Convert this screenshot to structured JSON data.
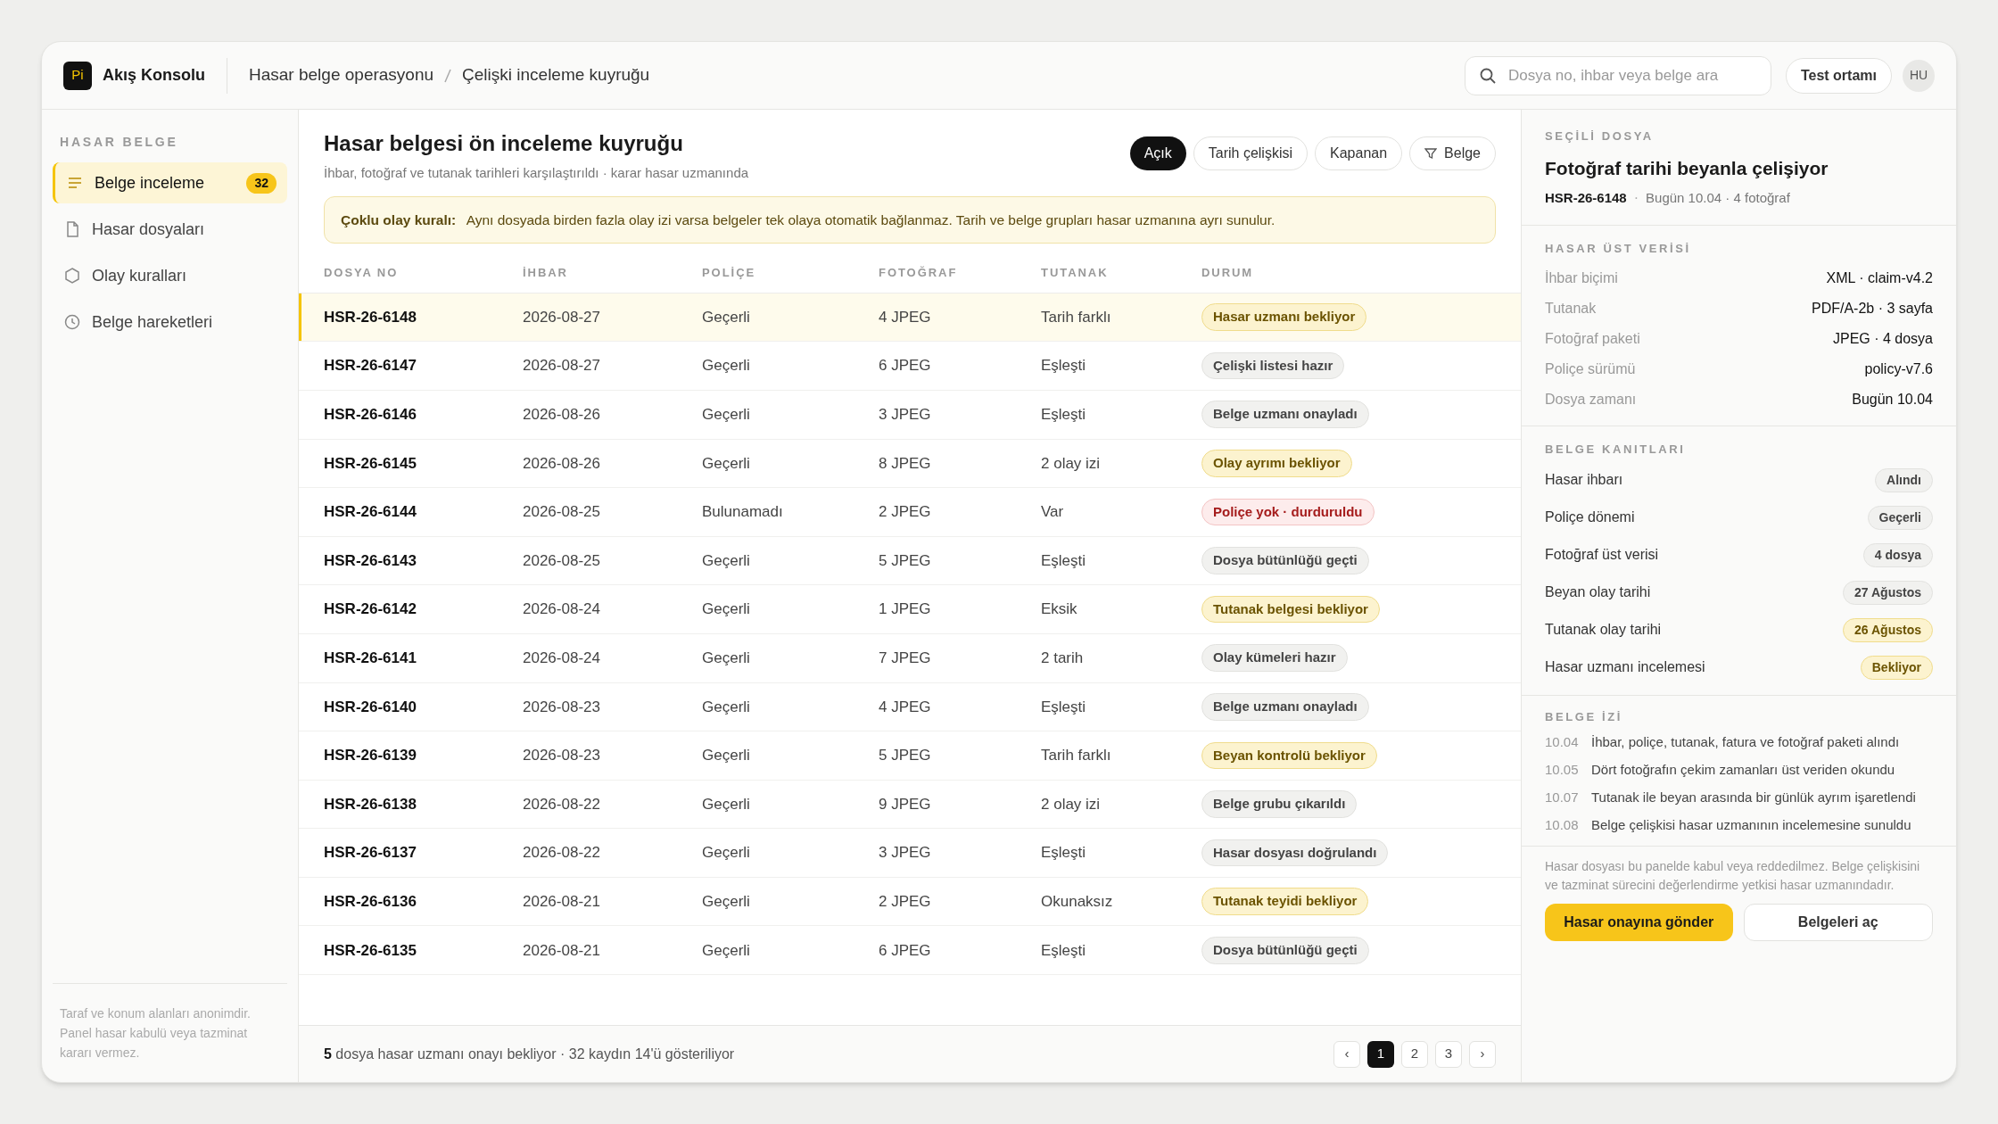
{
  "app": {
    "logo": "Pi",
    "name": "Akış Konsolu"
  },
  "breadcrumb": [
    "Hasar belge operasyonu",
    "Çelişki inceleme kuyruğu"
  ],
  "search": {
    "placeholder": "Dosya no, ihbar veya belge ara"
  },
  "environment": "Test ortamı",
  "avatar": "HU",
  "sidebar": {
    "heading": "HASAR BELGE",
    "items": [
      {
        "label": "Belge inceleme",
        "badge": "32",
        "selected": true
      },
      {
        "label": "Hasar dosyaları",
        "selected": false
      },
      {
        "label": "Olay kuralları",
        "selected": false
      },
      {
        "label": "Belge hareketleri",
        "selected": false
      }
    ],
    "note": "Taraf ve konum alanları anonimdir. Panel hasar kabulü veya tazminat kararı vermez."
  },
  "queue": {
    "title": "Hasar belgesi ön inceleme kuyruğu",
    "subtitle": "İhbar, fotoğraf ve tutanak tarihleri karşılaştırıldı · karar hasar uzmanında",
    "filters": [
      {
        "label": "Açık",
        "kind": "chip",
        "selected": true
      },
      {
        "label": "Tarih çelişkisi",
        "kind": "chip",
        "selected": false
      },
      {
        "label": "Kapanan",
        "kind": "chip",
        "selected": false
      },
      {
        "label": "Belge",
        "kind": "filter",
        "selected": false
      }
    ],
    "notice": "**Çoklu olay kuralı:** Aynı dosyada birden fazla olay izi varsa belgeler tek olaya otomatik bağlanmaz. Tarih ve belge grupları hasar uzmanına ayrı sunulur.",
    "columns": [
      "DOSYA NO",
      "İHBAR",
      "POLİÇE",
      "FOTOĞRAF",
      "TUTANAK",
      "DURUM"
    ],
    "rows": [
      {
        "cells": [
          "HSR-26-6148",
          "2026-08-27",
          "Geçerli",
          "4 JPEG",
          "Tarih farklı"
        ],
        "status": "Hasar uzmanı bekliyor",
        "color": "#6b5300",
        "selected": true
      },
      {
        "cells": [
          "HSR-26-6147",
          "2026-08-27",
          "Geçerli",
          "6 JPEG",
          "Eşleşti"
        ],
        "status": "Çelişki listesi hazır",
        "color": "#444444",
        "selected": false
      },
      {
        "cells": [
          "HSR-26-6146",
          "2026-08-26",
          "Geçerli",
          "3 JPEG",
          "Eşleşti"
        ],
        "status": "Belge uzmanı onayladı",
        "color": "#444444",
        "selected": false
      },
      {
        "cells": [
          "HSR-26-6145",
          "2026-08-26",
          "Geçerli",
          "8 JPEG",
          "2 olay izi"
        ],
        "status": "Olay ayrımı bekliyor",
        "color": "#6b5300",
        "selected": false
      },
      {
        "cells": [
          "HSR-26-6144",
          "2026-08-25",
          "Bulunamadı",
          "2 JPEG",
          "Var"
        ],
        "status": "Poliçe yok · durduruldu",
        "color": "#a51c1c",
        "selected": false
      },
      {
        "cells": [
          "HSR-26-6143",
          "2026-08-25",
          "Geçerli",
          "5 JPEG",
          "Eşleşti"
        ],
        "status": "Dosya bütünlüğü geçti",
        "color": "#444444",
        "selected": false
      },
      {
        "cells": [
          "HSR-26-6142",
          "2026-08-24",
          "Geçerli",
          "1 JPEG",
          "Eksik"
        ],
        "status": "Tutanak belgesi bekliyor",
        "color": "#6b5300",
        "selected": false
      },
      {
        "cells": [
          "HSR-26-6141",
          "2026-08-24",
          "Geçerli",
          "7 JPEG",
          "2 tarih"
        ],
        "status": "Olay kümeleri hazır",
        "color": "#444444",
        "selected": false
      },
      {
        "cells": [
          "HSR-26-6140",
          "2026-08-23",
          "Geçerli",
          "4 JPEG",
          "Eşleşti"
        ],
        "status": "Belge uzmanı onayladı",
        "color": "#444444",
        "selected": false
      },
      {
        "cells": [
          "HSR-26-6139",
          "2026-08-23",
          "Geçerli",
          "5 JPEG",
          "Tarih farklı"
        ],
        "status": "Beyan kontrolü bekliyor",
        "color": "#6b5300",
        "selected": false
      },
      {
        "cells": [
          "HSR-26-6138",
          "2026-08-22",
          "Geçerli",
          "9 JPEG",
          "2 olay izi"
        ],
        "status": "Belge grubu çıkarıldı",
        "color": "#444444",
        "selected": false
      },
      {
        "cells": [
          "HSR-26-6137",
          "2026-08-22",
          "Geçerli",
          "3 JPEG",
          "Eşleşti"
        ],
        "status": "Hasar dosyası doğrulandı",
        "color": "#444444",
        "selected": false
      },
      {
        "cells": [
          "HSR-26-6136",
          "2026-08-21",
          "Geçerli",
          "2 JPEG",
          "Okunaksız"
        ],
        "status": "Tutanak teyidi bekliyor",
        "color": "#6b5300",
        "selected": false
      },
      {
        "cells": [
          "HSR-26-6135",
          "2026-08-21",
          "Geçerli",
          "6 JPEG",
          "Eşleşti"
        ],
        "status": "Dosya bütünlüğü geçti",
        "color": "#444444",
        "selected": false
      }
    ],
    "footer": "**5** dosya hasar uzmanı onayı bekliyor · 32 kaydın 14'ü gösteriliyor",
    "pagination": {
      "prev": "‹",
      "next": "›",
      "pages": [
        {
          "label": "1",
          "selected": true
        },
        {
          "label": "2",
          "selected": false
        },
        {
          "label": "3",
          "selected": false
        }
      ]
    }
  },
  "detail": {
    "heading": "SEÇİLİ DOSYA",
    "title": "Fotoğraf tarihi beyanla çelişiyor",
    "file_no": "HSR-26-6148",
    "separator": "·",
    "meta": "Bugün 10.04 · 4 fotoğraf",
    "metadata_heading": "HASAR ÜST VERİSİ",
    "metadata": [
      [
        "İhbar biçimi",
        "XML · claim-v4.2"
      ],
      [
        "Tutanak",
        "PDF/A-2b · 3 sayfa"
      ],
      [
        "Fotoğraf paketi",
        "JPEG · 4 dosya"
      ],
      [
        "Poliçe sürümü",
        "policy-v7.6"
      ],
      [
        "Dosya zamanı",
        "Bugün 10.04"
      ]
    ],
    "evidence_heading": "BELGE KANITLARI",
    "evidence": [
      {
        "label": "Hasar ihbarı",
        "value": "Alındı",
        "color": "#444444"
      },
      {
        "label": "Poliçe dönemi",
        "value": "Geçerli",
        "color": "#444444"
      },
      {
        "label": "Fotoğraf üst verisi",
        "value": "4 dosya",
        "color": "#444444"
      },
      {
        "label": "Beyan olay tarihi",
        "value": "27 Ağustos",
        "color": "#444444"
      },
      {
        "label": "Tutanak olay tarihi",
        "value": "26 Ağustos",
        "color": "#6b5300"
      },
      {
        "label": "Hasar uzmanı incelemesi",
        "value": "Bekliyor",
        "color": "#6b5300"
      }
    ],
    "trail_heading": "BELGE İZİ",
    "trail": [
      [
        "10.04",
        "İhbar, poliçe, tutanak, fatura ve fotoğraf paketi alındı"
      ],
      [
        "10.05",
        "Dört fotoğrafın çekim zamanları üst veriden okundu"
      ],
      [
        "10.07",
        "Tutanak ile beyan arasında bir günlük ayrım işaretlendi"
      ],
      [
        "10.08",
        "Belge çelişkisi hasar uzmanının incelemesine sunuldu"
      ]
    ],
    "disclaimer": "Hasar dosyası bu panelde kabul veya reddedilmez. Belge çelişkisini ve tazminat sürecini değerlendirme yetkisi hasar uzmanındadır.",
    "primary_action": "Hasar onayına gönder",
    "secondary_action": "Belgeleri aç"
  }
}
